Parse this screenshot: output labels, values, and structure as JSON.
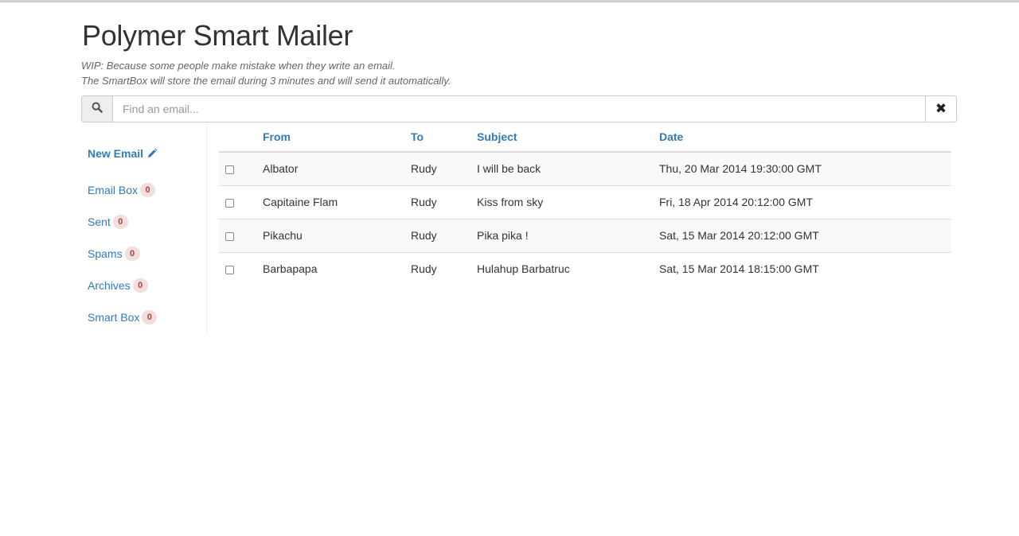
{
  "app": {
    "title": "Polymer Smart Mailer",
    "subtitle_line1": "WIP: Because some people make mistake when they write an email.",
    "subtitle_line2": "The SmartBox will store the email during 3 minutes and will send it automatically."
  },
  "search": {
    "placeholder": "Find an email...",
    "value": "",
    "icon": "search-icon",
    "clear_icon": "close-icon"
  },
  "sidebar": {
    "new_email": {
      "label": "New Email",
      "icon": "pencil-icon"
    },
    "items": [
      {
        "label": "Email Box",
        "count": "0"
      },
      {
        "label": "Sent",
        "count": "0"
      },
      {
        "label": "Spams",
        "count": "0"
      },
      {
        "label": "Archives",
        "count": "0"
      },
      {
        "label": "Smart Box",
        "count": "0"
      }
    ]
  },
  "table": {
    "headers": {
      "from": "From",
      "to": "To",
      "subject": "Subject",
      "date": "Date"
    },
    "rows": [
      {
        "from": "Albator",
        "to": "Rudy",
        "subject": "I will be back",
        "date": "Thu, 20 Mar 2014 19:30:00 GMT"
      },
      {
        "from": "Capitaine Flam",
        "to": "Rudy",
        "subject": "Kiss from sky",
        "date": "Fri, 18 Apr 2014 20:12:00 GMT"
      },
      {
        "from": "Pikachu",
        "to": "Rudy",
        "subject": "Pika pika !",
        "date": "Sat, 15 Mar 2014 20:12:00 GMT"
      },
      {
        "from": "Barbapapa",
        "to": "Rudy",
        "subject": "Hulahup Barbatruc",
        "date": "Sat, 15 Mar 2014 18:15:00 GMT"
      }
    ]
  },
  "colors": {
    "link": "#337ab7",
    "badge_bg": "#f2dede",
    "badge_text": "#a94442",
    "stripe": "#f9f9f9"
  }
}
